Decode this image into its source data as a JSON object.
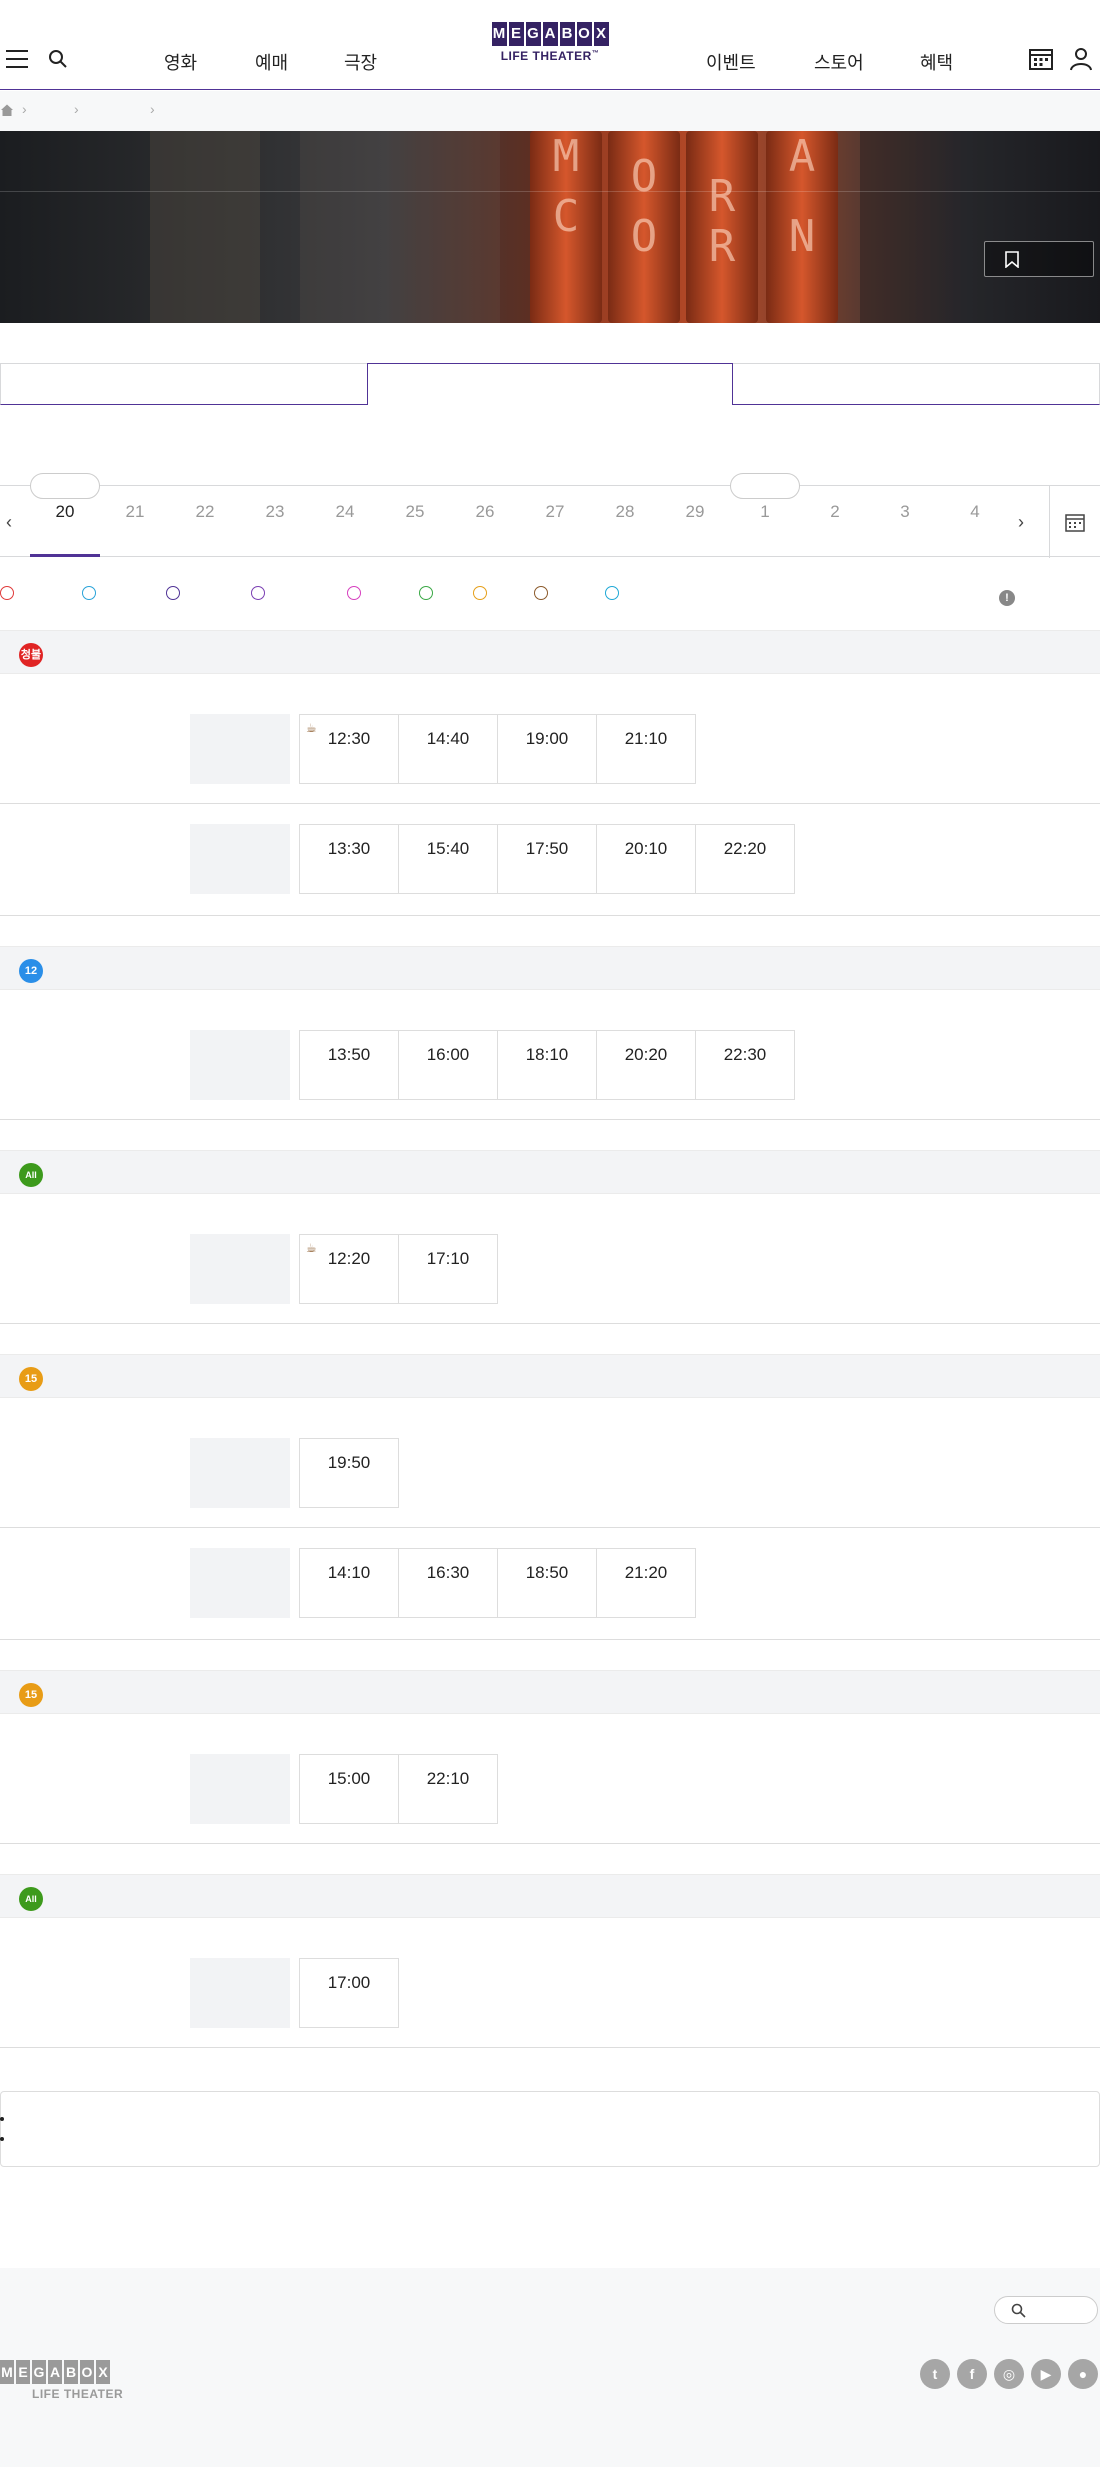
{
  "header": {
    "nav_left": [
      "영화",
      "예매",
      "극장"
    ],
    "nav_right": [
      "이벤트",
      "스토어",
      "혜택"
    ],
    "logo_letters": [
      "M",
      "E",
      "G",
      "A",
      "B",
      "O",
      "X"
    ],
    "logo_sub": "LIFE THEATER",
    "logo_tm": "™"
  },
  "breadcrumb": {
    "separator": "›"
  },
  "dates": {
    "prev": "‹",
    "next": "›",
    "items": [
      "20",
      "21",
      "22",
      "23",
      "24",
      "25",
      "26",
      "27",
      "28",
      "29",
      "1",
      "2",
      "3",
      "4"
    ],
    "active": "20"
  },
  "legend": {
    "icons": [
      {
        "name": "legend-icon-1",
        "color": "#e03a3a"
      },
      {
        "name": "legend-icon-2",
        "color": "#29a3d9"
      },
      {
        "name": "legend-icon-3",
        "color": "#503396"
      },
      {
        "name": "legend-icon-4",
        "color": "#7a3fb3"
      },
      {
        "name": "legend-icon-5",
        "color": "#d63fbf"
      },
      {
        "name": "legend-icon-6",
        "color": "#3aa845"
      },
      {
        "name": "legend-icon-7",
        "color": "#e6a01a"
      },
      {
        "name": "legend-icon-8",
        "color": "#8b5a2b"
      },
      {
        "name": "legend-icon-9",
        "color": "#1fa8d6"
      }
    ],
    "info": "!"
  },
  "movies": [
    {
      "rating": "청불",
      "rating_color": "#e02424",
      "rows": [
        {
          "times": [
            {
              "t": "12:30",
              "cup": true
            },
            {
              "t": "14:40"
            },
            {
              "t": "19:00"
            },
            {
              "t": "21:10"
            }
          ]
        },
        {
          "times": [
            {
              "t": "13:30"
            },
            {
              "t": "15:40"
            },
            {
              "t": "17:50"
            },
            {
              "t": "20:10"
            },
            {
              "t": "22:20"
            }
          ]
        }
      ]
    },
    {
      "rating": "12",
      "rating_color": "#2a8ee8",
      "rows": [
        {
          "times": [
            {
              "t": "13:50"
            },
            {
              "t": "16:00"
            },
            {
              "t": "18:10"
            },
            {
              "t": "20:20"
            },
            {
              "t": "22:30"
            }
          ]
        }
      ]
    },
    {
      "rating": "All",
      "rating_color": "#3d9a1c",
      "rows": [
        {
          "times": [
            {
              "t": "12:20",
              "cup": true
            },
            {
              "t": "17:10"
            }
          ]
        }
      ]
    },
    {
      "rating": "15",
      "rating_color": "#e89c16",
      "rows": [
        {
          "times": [
            {
              "t": "19:50"
            }
          ]
        },
        {
          "times": [
            {
              "t": "14:10"
            },
            {
              "t": "16:30"
            },
            {
              "t": "18:50"
            },
            {
              "t": "21:20"
            }
          ]
        }
      ]
    },
    {
      "rating": "15",
      "rating_color": "#e89c16",
      "rows": [
        {
          "times": [
            {
              "t": "15:00"
            },
            {
              "t": "22:10"
            }
          ]
        }
      ]
    },
    {
      "rating": "All",
      "rating_color": "#3d9a1c",
      "rows": [
        {
          "times": [
            {
              "t": "17:00"
            }
          ]
        }
      ]
    }
  ],
  "notice": {
    "bullets": [
      "",
      ""
    ]
  },
  "footer": {
    "logo_letters": [
      "M",
      "E",
      "G",
      "A",
      "B",
      "O",
      "X"
    ],
    "logo_sub": "LIFE THEATER",
    "sns": [
      {
        "name": "twitter-icon",
        "glyph": "t"
      },
      {
        "name": "facebook-icon",
        "glyph": "f"
      },
      {
        "name": "instagram-icon",
        "glyph": "◎"
      },
      {
        "name": "play-icon",
        "glyph": "▶"
      },
      {
        "name": "apple-icon",
        "glyph": "●"
      }
    ]
  }
}
